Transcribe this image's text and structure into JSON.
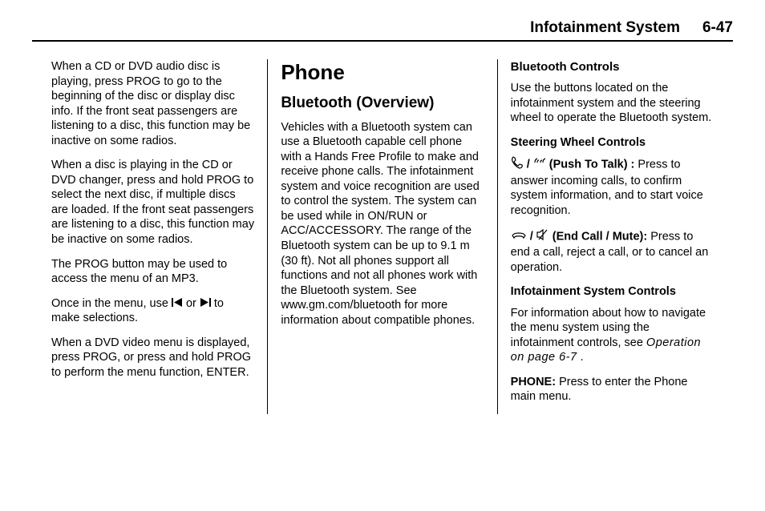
{
  "header": {
    "title": "Infotainment System",
    "pageno": "6-47"
  },
  "col1": {
    "p1": "When a CD or DVD audio disc is playing, press PROG to go to the beginning of the disc or display disc info. If the front seat passengers are listening to a disc, this function may be inactive on some radios.",
    "p2": "When a disc is playing in the CD or DVD changer, press and hold PROG to select the next disc, if multiple discs are loaded. If the front seat passengers are listening to a disc, this function may be inactive on some radios.",
    "p3": "The PROG button may be used to access the menu of an MP3.",
    "p4a": "Once in the menu, use ",
    "p4b": " or ",
    "p4c": " to make selections.",
    "p5": "When a DVD video menu is displayed, press PROG, or press and hold PROG to perform the menu function, ENTER."
  },
  "col2": {
    "h1": "Phone",
    "h2": "Bluetooth (Overview)",
    "p1": "Vehicles with a Bluetooth system can use a Bluetooth capable cell phone with a Hands Free Profile to make and receive phone calls. The infotainment system and voice recognition are used to control the system. The system can be used while in ON/RUN or ACC/ACCESSORY. The range of the Bluetooth system can be up to 9.1 m (30 ft). Not all phones support all functions and not all phones work with the Bluetooth system. See www.gm.com/bluetooth for more information about compatible phones."
  },
  "col3": {
    "h3": "Bluetooth Controls",
    "p1": "Use the buttons located on the infotainment system and the steering wheel to operate the Bluetooth system.",
    "h4a": "Steering Wheel Controls",
    "ptt_label": " (Push To Talk) : ",
    "ptt_text": " Press to answer incoming calls, to confirm system information, and to start voice recognition.",
    "end_label": " (End Call / Mute): ",
    "end_text": " Press to end a call, reject a call, or to cancel an operation.",
    "h4b": "Infotainment System Controls",
    "p2a": "For information about how to navigate the menu system using the infotainment controls, see ",
    "p2b": "Operation on page 6-7",
    "p2c": ".",
    "phone_label": "PHONE: ",
    "phone_text": " Press to enter the Phone main menu."
  }
}
